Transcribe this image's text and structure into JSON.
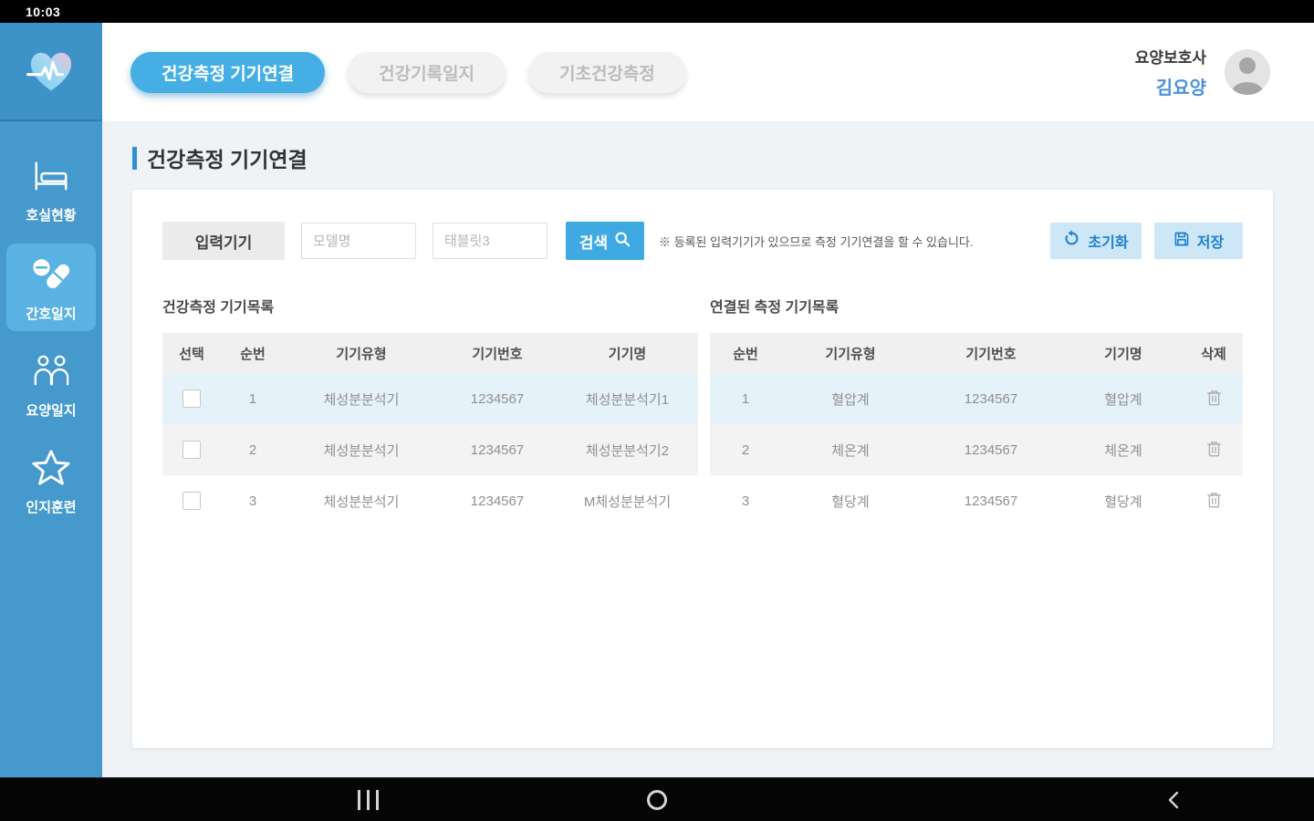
{
  "status_bar": {
    "time": "10:03"
  },
  "header": {
    "tabs": [
      {
        "label": "건강측정 기기연결",
        "active": true
      },
      {
        "label": "건강기록일지",
        "active": false
      },
      {
        "label": "기초건강측정",
        "active": false
      }
    ],
    "user_role": "요양보호사",
    "user_name": "김요양"
  },
  "sidebar": {
    "items": [
      {
        "label": "호실현황",
        "icon": "bed-icon",
        "active": false
      },
      {
        "label": "간호일지",
        "icon": "pills-icon",
        "active": true
      },
      {
        "label": "요양일지",
        "icon": "people-icon",
        "active": false
      },
      {
        "label": "인지훈련",
        "icon": "star-icon",
        "active": false
      }
    ]
  },
  "page": {
    "title": "건강측정 기기연결"
  },
  "search": {
    "device_label": "입력기기",
    "model_placeholder": "모델명",
    "tablet_placeholder": "태블릿3",
    "search_button": "검색",
    "note": "※ 등록된 입력기기가 있으므로 측정 기기연결을 할 수 있습니다.",
    "reset_button": "초기화",
    "save_button": "저장"
  },
  "left_table": {
    "title": "건강측정 기기목록",
    "headers": [
      "선택",
      "순번",
      "기기유형",
      "기기번호",
      "기기명"
    ],
    "rows": [
      {
        "no": "1",
        "type": "체성분분석기",
        "number": "1234567",
        "name": "체성분분석기1",
        "checked": false
      },
      {
        "no": "2",
        "type": "체성분분석기",
        "number": "1234567",
        "name": "체성분분석기2",
        "checked": false
      },
      {
        "no": "3",
        "type": "체성분분석기",
        "number": "1234567",
        "name": "M체성분분석기",
        "checked": false
      }
    ]
  },
  "right_table": {
    "title": "연결된 측정 기기목록",
    "headers": [
      "순번",
      "기기유형",
      "기기번호",
      "기기명",
      "삭제"
    ],
    "rows": [
      {
        "no": "1",
        "type": "혈압계",
        "number": "1234567",
        "name": "혈압계"
      },
      {
        "no": "2",
        "type": "체온계",
        "number": "1234567",
        "name": "체온계"
      },
      {
        "no": "3",
        "type": "혈당계",
        "number": "1234567",
        "name": "혈당계"
      }
    ]
  },
  "colors": {
    "sidebar_blue": "#4599cd",
    "active_item_blue": "#5ab2e2",
    "accent_blue": "#45afe5",
    "button_blue": "#3fa9e1",
    "soft_button_bg": "#cde7f7",
    "soft_button_text": "#1c80d0",
    "row_highlight": "#e6f2fa",
    "row_alt": "#f3f3f3",
    "user_name_blue": "#4a90d9"
  },
  "android_nav": {
    "recents": "recents",
    "home": "home",
    "back": "back"
  }
}
